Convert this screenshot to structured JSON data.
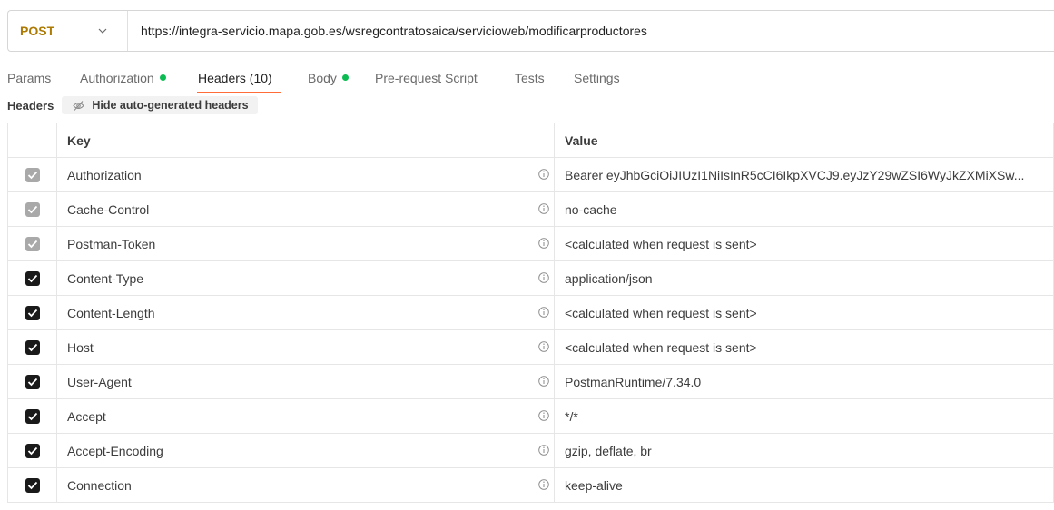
{
  "request": {
    "method": "POST",
    "url": "https://integra-servicio.mapa.gob.es/wsregcontratosaica/servicioweb/modificarproductores"
  },
  "tabs": [
    {
      "label": "Params",
      "dot": false,
      "active": false
    },
    {
      "label": "Authorization",
      "dot": true,
      "active": false
    },
    {
      "label": "Headers (10)",
      "dot": false,
      "active": true
    },
    {
      "label": "Body",
      "dot": true,
      "active": false
    },
    {
      "label": "Pre-request Script",
      "dot": false,
      "active": false
    },
    {
      "label": "Tests",
      "dot": false,
      "active": false
    },
    {
      "label": "Settings",
      "dot": false,
      "active": false
    }
  ],
  "subheader": {
    "title": "Headers",
    "hide_button": "Hide auto-generated headers"
  },
  "table": {
    "columns": {
      "key": "Key",
      "value": "Value"
    },
    "rows": [
      {
        "key": "Authorization",
        "value": "Bearer eyJhbGciOiJIUzI1NiIsInR5cCI6IkpXVCJ9.eyJzY29wZSI6WyJkZXMiXSw...",
        "checked": true,
        "auto": true
      },
      {
        "key": "Cache-Control",
        "value": "no-cache",
        "checked": true,
        "auto": true
      },
      {
        "key": "Postman-Token",
        "value": "<calculated when request is sent>",
        "checked": true,
        "auto": true
      },
      {
        "key": "Content-Type",
        "value": "application/json",
        "checked": true,
        "auto": false
      },
      {
        "key": "Content-Length",
        "value": "<calculated when request is sent>",
        "checked": true,
        "auto": false
      },
      {
        "key": "Host",
        "value": "<calculated when request is sent>",
        "checked": true,
        "auto": false
      },
      {
        "key": "User-Agent",
        "value": "PostmanRuntime/7.34.0",
        "checked": true,
        "auto": false
      },
      {
        "key": "Accept",
        "value": "*/*",
        "checked": true,
        "auto": false
      },
      {
        "key": "Accept-Encoding",
        "value": "gzip, deflate, br",
        "checked": true,
        "auto": false
      },
      {
        "key": "Connection",
        "value": "keep-alive",
        "checked": true,
        "auto": false
      }
    ]
  },
  "colors": {
    "method": "#ad7a03",
    "active_underline": "#ff6c37",
    "status_dot": "#0cbb52"
  }
}
